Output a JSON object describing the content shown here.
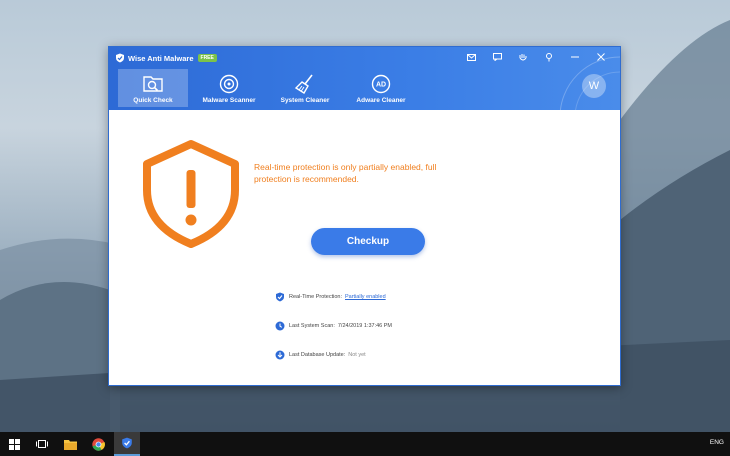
{
  "app": {
    "title": "Wise Anti Malware",
    "badge": "FREE"
  },
  "window_controls": [
    "mail-icon",
    "feedback-icon",
    "skin-icon",
    "pin-icon",
    "minimize-icon",
    "close-icon"
  ],
  "nav": {
    "tabs": [
      {
        "label": "Quick Check",
        "icon": "quick-check-icon",
        "active": true
      },
      {
        "label": "Malware Scanner",
        "icon": "scanner-icon",
        "active": false
      },
      {
        "label": "System Cleaner",
        "icon": "broom-icon",
        "active": false
      },
      {
        "label": "Adware Cleaner",
        "icon": "ad-icon",
        "active": false
      }
    ]
  },
  "avatar": "W",
  "main": {
    "warning_line1": "Real-time protection is only partially enabled, full",
    "warning_line2": "protection is recommended.",
    "checkup_label": "Checkup"
  },
  "status": {
    "realtime_label": "Real-Time Protection:",
    "realtime_value": "Partially enabled",
    "scan_label": "Last System Scan:",
    "scan_value": "7/24/2019 1:37:46 PM",
    "db_label": "Last Database Update:",
    "db_value": "Not yet"
  },
  "taskbar": {
    "language": "ENG",
    "items": [
      "windows-start-icon",
      "task-view-icon",
      "file-explorer-icon",
      "chrome-icon",
      "wise-anti-malware-icon"
    ]
  },
  "colors": {
    "accent_blue": "#3a7be8",
    "warning_orange": "#f07f1f",
    "link_blue": "#2d6ad6"
  }
}
